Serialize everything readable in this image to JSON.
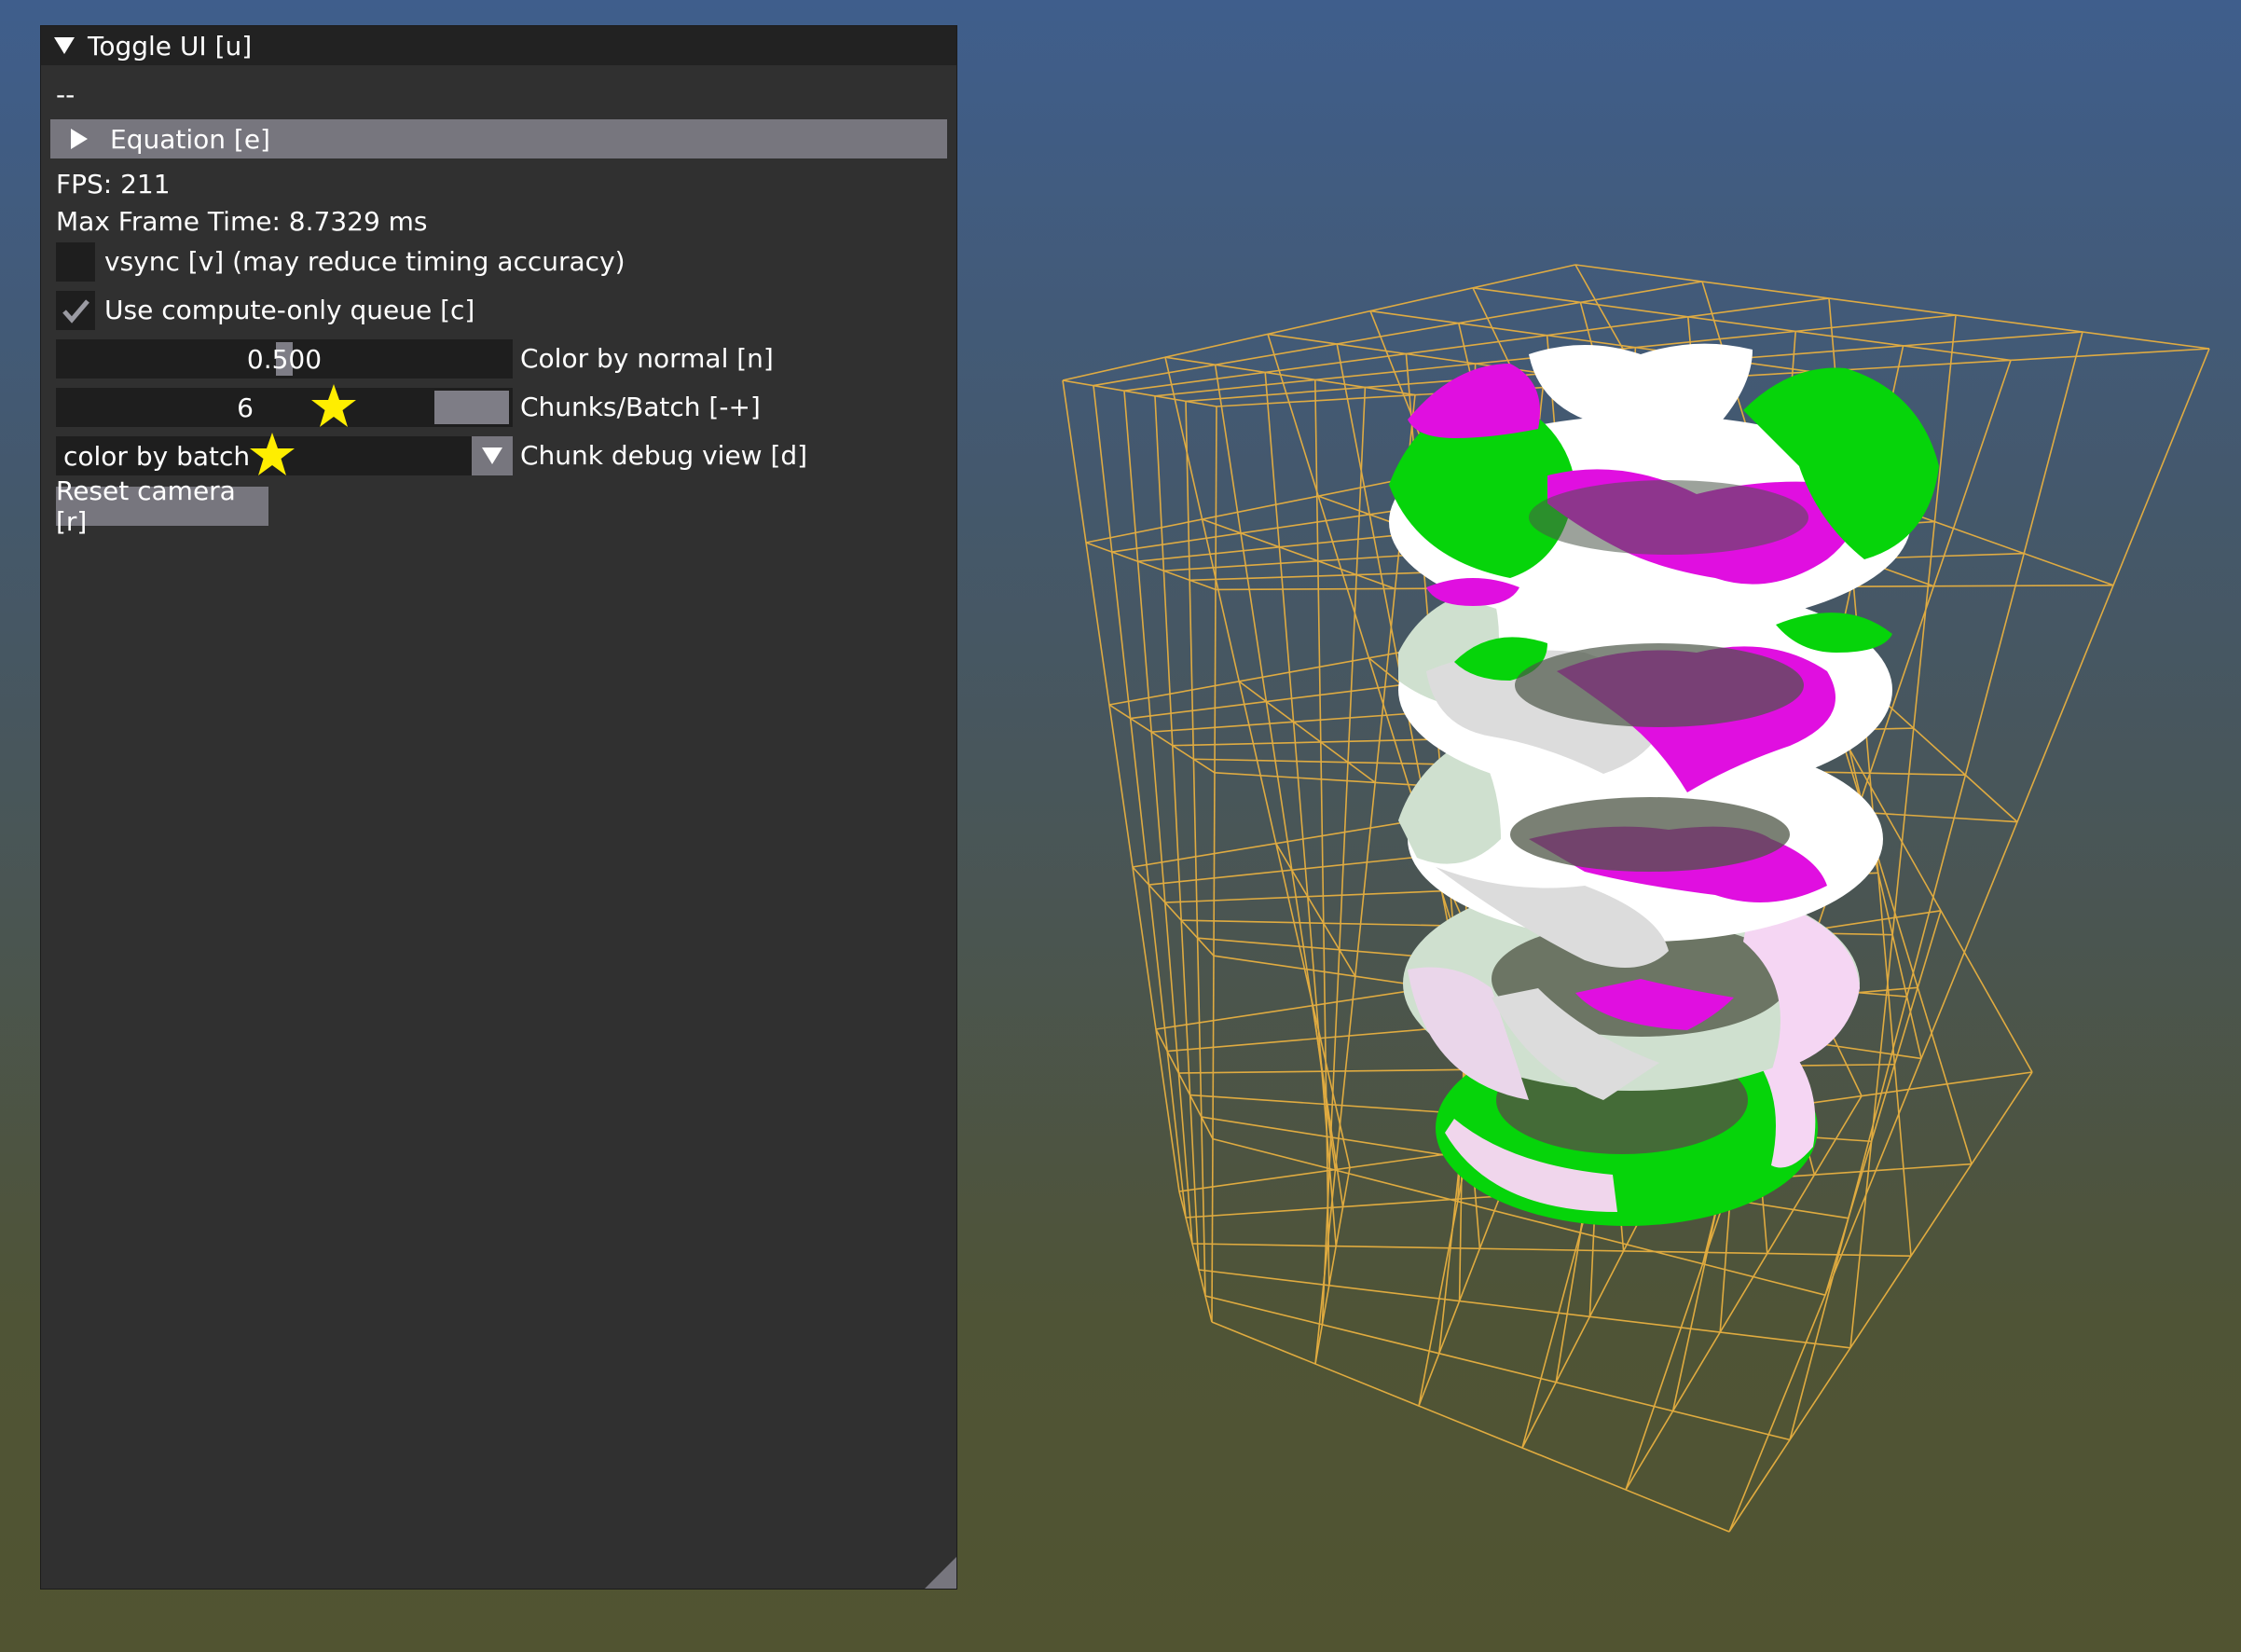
{
  "panel": {
    "title": "Toggle UI [u]",
    "separator_text": "--",
    "equation_header": "Equation [e]",
    "fps": "FPS: 211",
    "max_frame_time": "Max Frame Time:  8.7329 ms",
    "vsync": {
      "label": "vsync [v] (may reduce timing accuracy)",
      "checked": false
    },
    "compute_queue": {
      "label": "Use compute-only queue [c]",
      "checked": true
    },
    "color_by_normal": {
      "value": "0.500",
      "label": "Color by normal [n]",
      "fraction": 0.5
    },
    "chunks_per_batch": {
      "value": "6",
      "label": "Chunks/Batch [-+]"
    },
    "chunk_debug_view": {
      "selected": "color by batch",
      "label": "Chunk debug view [d]"
    },
    "reset_camera": "Reset camera [r]"
  },
  "colors": {
    "panel_bg": "#303030",
    "title_bg": "#222222",
    "header_bg": "#77767e",
    "field_bg": "#1e1e1e",
    "wireframe": "#e8b040",
    "surface_green": "#06d40a",
    "surface_magenta": "#e00fe0",
    "surface_white": "#ffffff",
    "surface_pale_green": "#cfe0cf",
    "surface_pale_pink": "#f5d6f3",
    "star": "#ffee00"
  },
  "icons": {
    "title_collapse": "triangle-down-icon",
    "equation_expand": "triangle-right-icon",
    "compute_check": "checkmark-icon",
    "dropdown": "triangle-down-icon",
    "annotation": "star-icon",
    "resize": "resize-grip-icon"
  }
}
